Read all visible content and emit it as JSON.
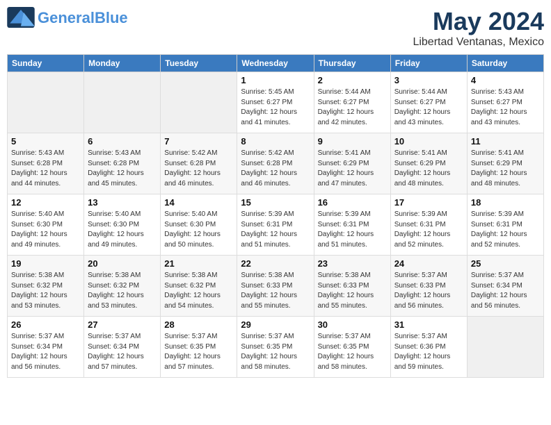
{
  "header": {
    "logo_line1": "General",
    "logo_line2": "Blue",
    "month": "May 2024",
    "location": "Libertad Ventanas, Mexico"
  },
  "weekdays": [
    "Sunday",
    "Monday",
    "Tuesday",
    "Wednesday",
    "Thursday",
    "Friday",
    "Saturday"
  ],
  "weeks": [
    [
      {
        "day": "",
        "info": ""
      },
      {
        "day": "",
        "info": ""
      },
      {
        "day": "",
        "info": ""
      },
      {
        "day": "1",
        "info": "Sunrise: 5:45 AM\nSunset: 6:27 PM\nDaylight: 12 hours\nand 41 minutes."
      },
      {
        "day": "2",
        "info": "Sunrise: 5:44 AM\nSunset: 6:27 PM\nDaylight: 12 hours\nand 42 minutes."
      },
      {
        "day": "3",
        "info": "Sunrise: 5:44 AM\nSunset: 6:27 PM\nDaylight: 12 hours\nand 43 minutes."
      },
      {
        "day": "4",
        "info": "Sunrise: 5:43 AM\nSunset: 6:27 PM\nDaylight: 12 hours\nand 43 minutes."
      }
    ],
    [
      {
        "day": "5",
        "info": "Sunrise: 5:43 AM\nSunset: 6:28 PM\nDaylight: 12 hours\nand 44 minutes."
      },
      {
        "day": "6",
        "info": "Sunrise: 5:43 AM\nSunset: 6:28 PM\nDaylight: 12 hours\nand 45 minutes."
      },
      {
        "day": "7",
        "info": "Sunrise: 5:42 AM\nSunset: 6:28 PM\nDaylight: 12 hours\nand 46 minutes."
      },
      {
        "day": "8",
        "info": "Sunrise: 5:42 AM\nSunset: 6:28 PM\nDaylight: 12 hours\nand 46 minutes."
      },
      {
        "day": "9",
        "info": "Sunrise: 5:41 AM\nSunset: 6:29 PM\nDaylight: 12 hours\nand 47 minutes."
      },
      {
        "day": "10",
        "info": "Sunrise: 5:41 AM\nSunset: 6:29 PM\nDaylight: 12 hours\nand 48 minutes."
      },
      {
        "day": "11",
        "info": "Sunrise: 5:41 AM\nSunset: 6:29 PM\nDaylight: 12 hours\nand 48 minutes."
      }
    ],
    [
      {
        "day": "12",
        "info": "Sunrise: 5:40 AM\nSunset: 6:30 PM\nDaylight: 12 hours\nand 49 minutes."
      },
      {
        "day": "13",
        "info": "Sunrise: 5:40 AM\nSunset: 6:30 PM\nDaylight: 12 hours\nand 49 minutes."
      },
      {
        "day": "14",
        "info": "Sunrise: 5:40 AM\nSunset: 6:30 PM\nDaylight: 12 hours\nand 50 minutes."
      },
      {
        "day": "15",
        "info": "Sunrise: 5:39 AM\nSunset: 6:31 PM\nDaylight: 12 hours\nand 51 minutes."
      },
      {
        "day": "16",
        "info": "Sunrise: 5:39 AM\nSunset: 6:31 PM\nDaylight: 12 hours\nand 51 minutes."
      },
      {
        "day": "17",
        "info": "Sunrise: 5:39 AM\nSunset: 6:31 PM\nDaylight: 12 hours\nand 52 minutes."
      },
      {
        "day": "18",
        "info": "Sunrise: 5:39 AM\nSunset: 6:31 PM\nDaylight: 12 hours\nand 52 minutes."
      }
    ],
    [
      {
        "day": "19",
        "info": "Sunrise: 5:38 AM\nSunset: 6:32 PM\nDaylight: 12 hours\nand 53 minutes."
      },
      {
        "day": "20",
        "info": "Sunrise: 5:38 AM\nSunset: 6:32 PM\nDaylight: 12 hours\nand 53 minutes."
      },
      {
        "day": "21",
        "info": "Sunrise: 5:38 AM\nSunset: 6:32 PM\nDaylight: 12 hours\nand 54 minutes."
      },
      {
        "day": "22",
        "info": "Sunrise: 5:38 AM\nSunset: 6:33 PM\nDaylight: 12 hours\nand 55 minutes."
      },
      {
        "day": "23",
        "info": "Sunrise: 5:38 AM\nSunset: 6:33 PM\nDaylight: 12 hours\nand 55 minutes."
      },
      {
        "day": "24",
        "info": "Sunrise: 5:37 AM\nSunset: 6:33 PM\nDaylight: 12 hours\nand 56 minutes."
      },
      {
        "day": "25",
        "info": "Sunrise: 5:37 AM\nSunset: 6:34 PM\nDaylight: 12 hours\nand 56 minutes."
      }
    ],
    [
      {
        "day": "26",
        "info": "Sunrise: 5:37 AM\nSunset: 6:34 PM\nDaylight: 12 hours\nand 56 minutes."
      },
      {
        "day": "27",
        "info": "Sunrise: 5:37 AM\nSunset: 6:34 PM\nDaylight: 12 hours\nand 57 minutes."
      },
      {
        "day": "28",
        "info": "Sunrise: 5:37 AM\nSunset: 6:35 PM\nDaylight: 12 hours\nand 57 minutes."
      },
      {
        "day": "29",
        "info": "Sunrise: 5:37 AM\nSunset: 6:35 PM\nDaylight: 12 hours\nand 58 minutes."
      },
      {
        "day": "30",
        "info": "Sunrise: 5:37 AM\nSunset: 6:35 PM\nDaylight: 12 hours\nand 58 minutes."
      },
      {
        "day": "31",
        "info": "Sunrise: 5:37 AM\nSunset: 6:36 PM\nDaylight: 12 hours\nand 59 minutes."
      },
      {
        "day": "",
        "info": ""
      }
    ]
  ]
}
